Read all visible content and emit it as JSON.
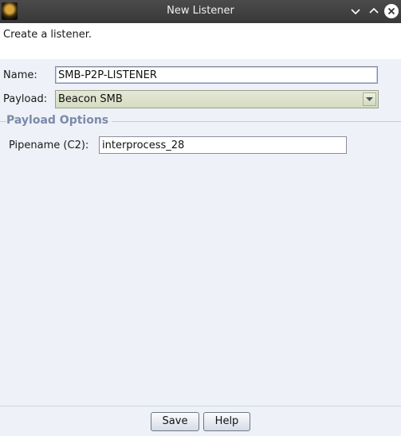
{
  "window": {
    "title": "New Listener",
    "icons": {
      "app": "app-icon",
      "minimize": "chevron-down-icon",
      "maximize": "chevron-up-icon",
      "close": "close-icon"
    }
  },
  "header": {
    "text": "Create a listener."
  },
  "form": {
    "name_label": "Name:",
    "name_value": "SMB-P2P-LISTENER",
    "payload_label": "Payload:",
    "payload_value": "Beacon SMB",
    "payload_dropdown_icon": "dropdown-arrow-icon"
  },
  "payload_options": {
    "title": "Payload Options",
    "pipename_label": "Pipename (C2):",
    "pipename_value": "interprocess_28"
  },
  "buttons": {
    "save": "Save",
    "help": "Help"
  }
}
